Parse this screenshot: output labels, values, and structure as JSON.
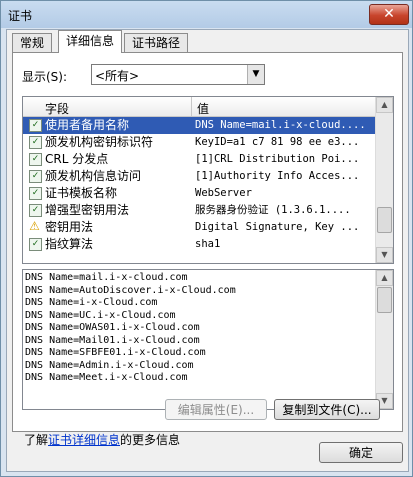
{
  "window": {
    "title": "证书",
    "close_glyph": "✕"
  },
  "tabs": [
    {
      "label": "常规",
      "active": false
    },
    {
      "label": "详细信息",
      "active": true
    },
    {
      "label": "证书路径",
      "active": false
    }
  ],
  "show": {
    "label": "显示(S):",
    "value": "<所有>",
    "arrow": "▼"
  },
  "list": {
    "col_field": "字段",
    "col_value": "值",
    "rows": [
      {
        "field": "使用者备用名称",
        "value": "DNS Name=mail.i-x-cloud....",
        "icon": "✓",
        "selected": true,
        "warn": false
      },
      {
        "field": "颁发机构密钥标识符",
        "value": "KeyID=a1 c7 81 98 ee e3...",
        "icon": "✓",
        "selected": false,
        "warn": false
      },
      {
        "field": "CRL 分发点",
        "value": "[1]CRL Distribution Poi...",
        "icon": "✓",
        "selected": false,
        "warn": false
      },
      {
        "field": "颁发机构信息访问",
        "value": "[1]Authority Info Acces...",
        "icon": "✓",
        "selected": false,
        "warn": false
      },
      {
        "field": "证书模板名称",
        "value": "WebServer",
        "icon": "✓",
        "selected": false,
        "warn": false
      },
      {
        "field": "增强型密钥用法",
        "value": "服务器身份验证 (1.3.6.1....",
        "icon": "✓",
        "selected": false,
        "warn": false
      },
      {
        "field": "密钥用法",
        "value": "Digital Signature, Key ...",
        "icon": "⚠",
        "selected": false,
        "warn": true
      },
      {
        "field": "指纹算法",
        "value": "sha1",
        "icon": "✓",
        "selected": false,
        "warn": false
      }
    ]
  },
  "detail_lines": [
    "DNS Name=mail.i-x-cloud.com",
    "DNS Name=AutoDiscover.i-x-Cloud.com",
    "DNS Name=i-x-Cloud.com",
    "DNS Name=UC.i-x-Cloud.com",
    "DNS Name=OWAS01.i-x-Cloud.com",
    "DNS Name=Mail01.i-x-Cloud.com",
    "DNS Name=SFBFE01.i-x-Cloud.com",
    "DNS Name=Admin.i-x-Cloud.com",
    "DNS Name=Meet.i-x-Cloud.com"
  ],
  "buttons": {
    "edit_properties": "编辑属性(E)...",
    "copy_to_file": "复制到文件(C)...",
    "ok": "确定"
  },
  "learn_more": {
    "prefix": "了解",
    "link": "证书详细信息",
    "suffix": "的更多信息"
  },
  "scroll_up": "▲",
  "scroll_down": "▼"
}
